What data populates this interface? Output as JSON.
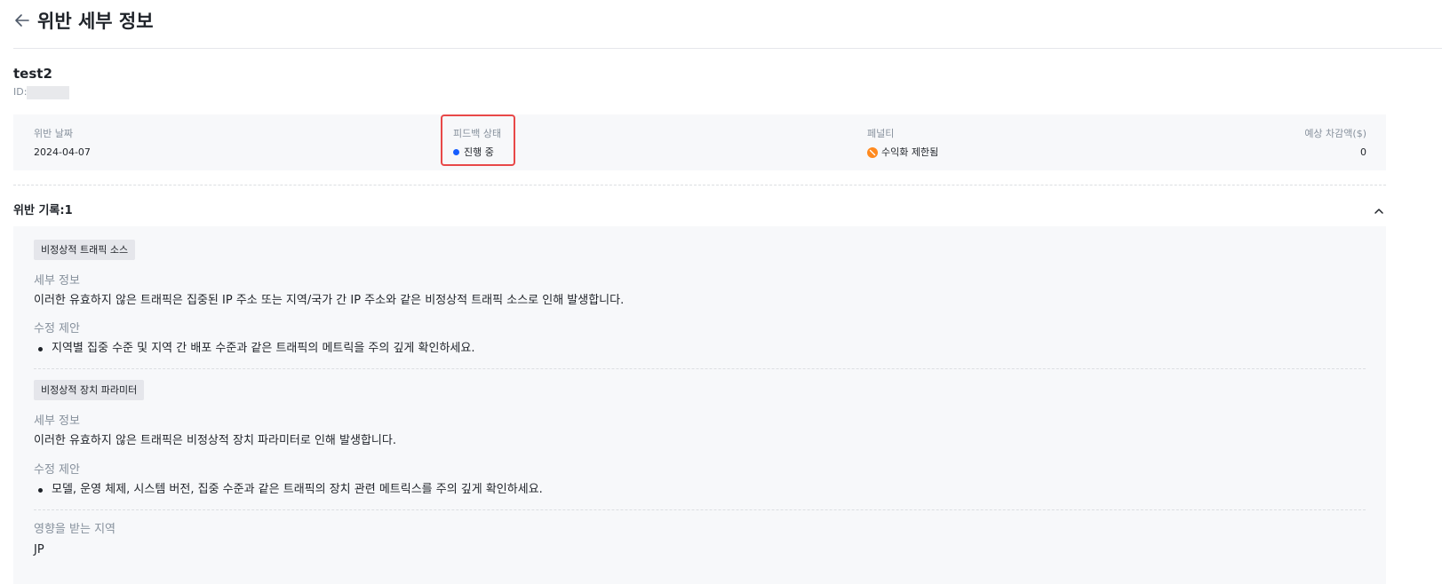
{
  "header": {
    "title": "위반 세부 정보"
  },
  "app": {
    "name": "test2",
    "id_label": "ID:"
  },
  "summary": {
    "date_label": "위반 날짜",
    "date_value": "2024-04-07",
    "feedback_label": "피드백 상태",
    "feedback_value": "진행 중",
    "penalty_label": "페널티",
    "penalty_value": "수익화 제한됨",
    "amount_label": "예상 차감액($)",
    "amount_value": "0"
  },
  "records": {
    "title": "위반 기록:1",
    "items": [
      {
        "tag": "비정상적 트래픽 소스",
        "details_label": "세부 정보",
        "details_text": "이러한 유효하지 않은 트래픽은 집중된 IP 주소 또는 지역/국가 간 IP 주소와 같은 비정상적 트래픽 소스로 인해 발생합니다.",
        "suggestion_label": "수정 제안",
        "suggestion_text": "지역별 집중 수준 및 지역 간 배포 수준과 같은 트래픽의 메트릭을 주의 깊게 확인하세요."
      },
      {
        "tag": "비정상적 장치 파라미터",
        "details_label": "세부 정보",
        "details_text": "이러한 유효하지 않은 트래픽은 비정상적 장치 파라미터로 인해 발생합니다.",
        "suggestion_label": "수정 제안",
        "suggestion_text": "모델, 운영 체제, 시스템 버전, 집중 수준과 같은 트래픽의 장치 관련 메트릭스를 주의 깊게 확인하세요."
      }
    ],
    "region_label": "영향을 받는 지역",
    "region_value": "JP"
  },
  "colors": {
    "status_dot": "#165dff",
    "penalty_icon": "#ff8a1f",
    "highlight": "#e84848"
  }
}
